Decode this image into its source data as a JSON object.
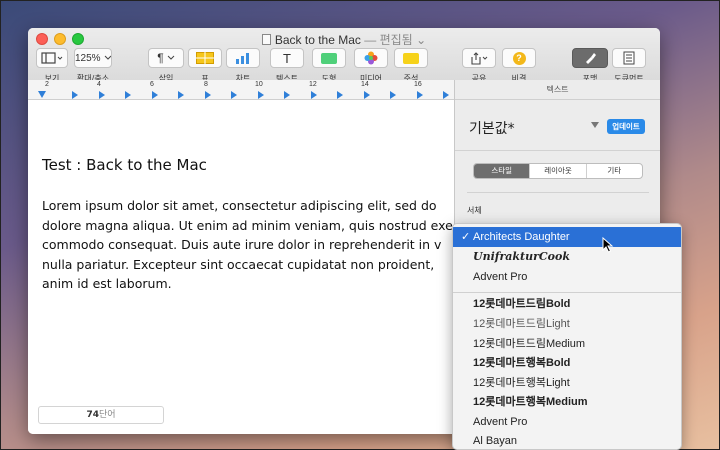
{
  "window": {
    "title": "Back to the Mac",
    "title_suffix": "— 편집됨",
    "edited_caret": "⌄"
  },
  "toolbar": {
    "view_label": "보기",
    "zoom_value": "125%",
    "zoom_label": "확대/축소",
    "insert_label": "삽입",
    "table_label": "표",
    "chart_label": "차트",
    "text_label": "텍스트",
    "shape_label": "도형",
    "media_label": "미디어",
    "comment_label": "주석",
    "share_label": "공유",
    "tips_label": "비결",
    "format_label": "포맷",
    "document_label": "도큐먼트",
    "insert_glyph": "¶",
    "text_glyph": "T",
    "tips_glyph": "?"
  },
  "ruler": {
    "numbers": [
      "2",
      "4",
      "6",
      "8",
      "10",
      "12",
      "14",
      "16"
    ]
  },
  "document": {
    "heading": "Test : Back to the Mac",
    "body_lines": [
      "Lorem ipsum dolor sit amet, consectetur adipiscing elit, sed do",
      "dolore magna aliqua. Ut enim ad minim veniam, quis nostrud exerc",
      "commodo consequat. Duis aute irure dolor in reprehenderit in v",
      "nulla pariatur. Excepteur sint occaecat cupidatat non proident,",
      "anim id est laborum."
    ]
  },
  "status": {
    "word_count": "74",
    "word_unit": "단어"
  },
  "sidebar": {
    "header": "텍스트",
    "style_name": "기본값*",
    "update_button": "업데이트",
    "tabs": [
      "스타일",
      "레이아웃",
      "기타"
    ],
    "active_tab": "스타일",
    "font_label": "서체"
  },
  "font_menu": {
    "check": "✓",
    "items": [
      "Architects Daughter",
      "UnifrakturCook",
      "Advent Pro",
      "12롯데마트드림Bold",
      "12롯데마트드림Light",
      "12롯데마트드림Medium",
      "12롯데마트행복Bold",
      "12롯데마트행복Light",
      "12롯데마트행복Medium",
      "Advent Pro",
      "Al Bayan"
    ],
    "selected": "Architects Daughter"
  },
  "colors": {
    "accent": "#2a70d6",
    "close": "#fc5f57",
    "minimize": "#fdbc2e",
    "maximize": "#28c840"
  }
}
